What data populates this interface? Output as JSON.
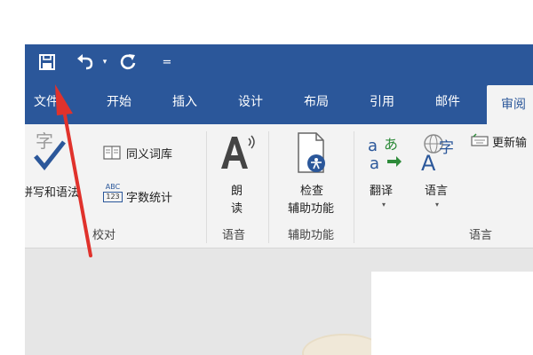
{
  "quick_access": {
    "save_icon": "save-icon",
    "undo_icon": "undo-icon",
    "undo_dropdown_glyph": "▾",
    "redo_icon": "redo-icon",
    "customize_glyph": "="
  },
  "tabs": [
    {
      "label": "文件"
    },
    {
      "label": "开始"
    },
    {
      "label": "插入"
    },
    {
      "label": "设计"
    },
    {
      "label": "布局"
    },
    {
      "label": "引用"
    },
    {
      "label": "邮件"
    },
    {
      "label": "审阅"
    }
  ],
  "ribbon": {
    "proofing": {
      "spelling_label": "拼写和语法",
      "thesaurus_label": "同义词库",
      "word_count_label": "字数统计",
      "word_count_icon_text": "ABC",
      "word_count_icon_nums": "123",
      "group_label": "校对"
    },
    "speech": {
      "read_aloud_line1": "朗",
      "read_aloud_line2": "读",
      "group_label": "语音"
    },
    "accessibility": {
      "check_line1": "检查",
      "check_line2": "辅助功能",
      "group_label": "辅助功能"
    },
    "language": {
      "translate_label": "翻译",
      "language_label": "语言",
      "update_ime_label": "更新输",
      "group_label": "语言",
      "dropdown_glyph": "▾"
    }
  },
  "colors": {
    "titlebar": "#2b579a",
    "ribbon_bg": "#f3f3f3",
    "annotation_arrow": "#e0322c"
  }
}
